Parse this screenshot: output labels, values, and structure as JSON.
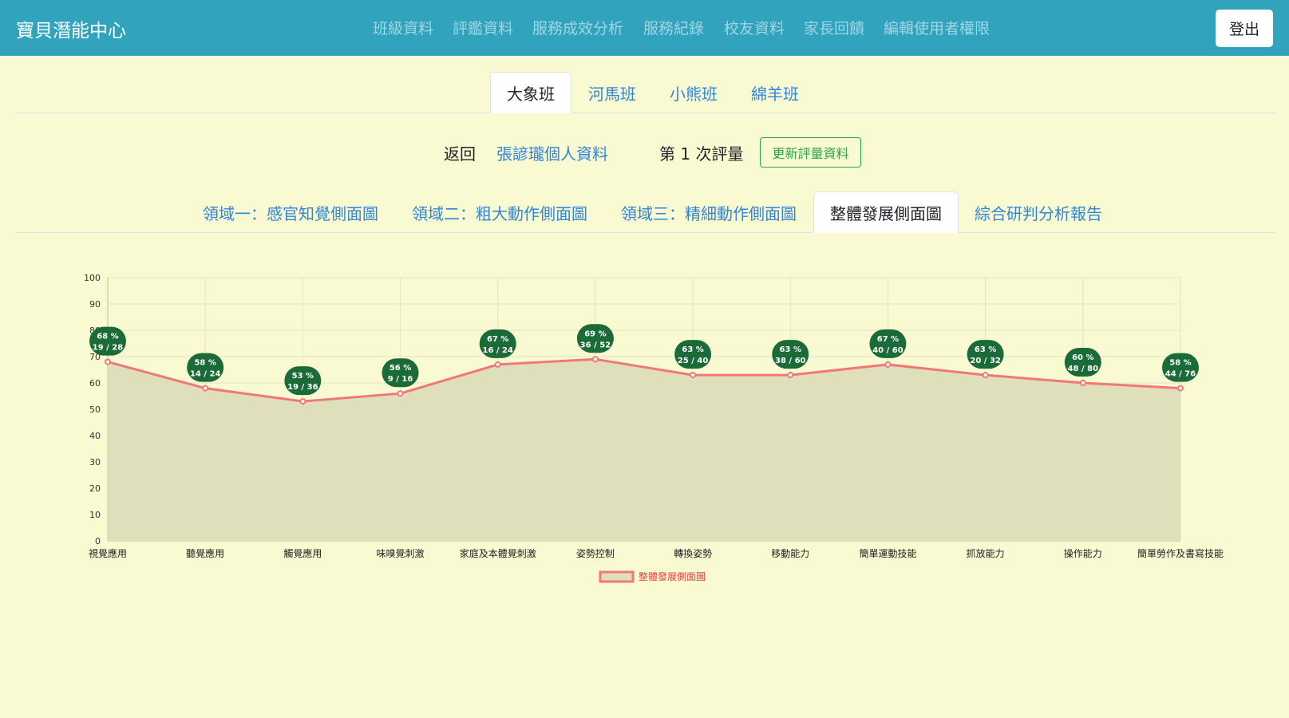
{
  "navbar": {
    "brand": "寶貝潛能中心",
    "links": [
      "班級資料",
      "評鑑資料",
      "服務成效分析",
      "服務紀錄",
      "校友資料",
      "家長回饋",
      "編輯使用者權限"
    ],
    "logout": "登出"
  },
  "class_tabs": [
    "大象班",
    "河馬班",
    "小熊班",
    "綿羊班"
  ],
  "student_bar": {
    "back": "返回",
    "profile_link": "張諺瓏個人資料",
    "assessment": "第 1 次評量",
    "update_button": "更新評量資料"
  },
  "domain_tabs": [
    "領域一：感官知覺側面圖",
    "領域二：粗大動作側面圖",
    "領域三：精細動作側面圖",
    "整體發展側面圖",
    "綜合研判分析報告"
  ],
  "colors": {
    "navbar": "#31a3bd",
    "page_background": "#fafad2",
    "line": "#f07878",
    "area_fill": "#dfdfbb",
    "label_badge": "#1a6b38",
    "button_outline": "#28a745",
    "link": "#2f86d8",
    "legend_text": "#e8413c"
  },
  "chart_data": {
    "type": "area",
    "categories": [
      "視覺應用",
      "聽覺應用",
      "觸覺應用",
      "味嗅覺刺激",
      "家庭及本體覺刺激",
      "姿勢控制",
      "轉換姿勢",
      "移動能力",
      "簡單運動技能",
      "抓放能力",
      "操作能力",
      "簡單勞作及書寫技能"
    ],
    "series": [
      {
        "name": "整體發展側面圖",
        "values": [
          68,
          58,
          53,
          56,
          67,
          69,
          63,
          63,
          67,
          63,
          60,
          58
        ],
        "percent_labels": [
          "68 %",
          "58 %",
          "53 %",
          "56 %",
          "67 %",
          "69 %",
          "63 %",
          "63 %",
          "67 %",
          "63 %",
          "60 %",
          "58 %"
        ],
        "fraction_labels": [
          "19 / 28",
          "14 / 24",
          "19 / 36",
          "9 / 16",
          "16 / 24",
          "36 / 52",
          "25 / 40",
          "38 / 60",
          "40 / 60",
          "20 / 32",
          "48 / 80",
          "44 / 76"
        ]
      }
    ],
    "ylim": [
      0,
      100
    ],
    "y_ticks": [
      "0",
      "10",
      "20",
      "30",
      "40",
      "50",
      "60",
      "70",
      "80",
      "90",
      "100"
    ],
    "grid": true,
    "legend_placement": "bottom-center"
  }
}
